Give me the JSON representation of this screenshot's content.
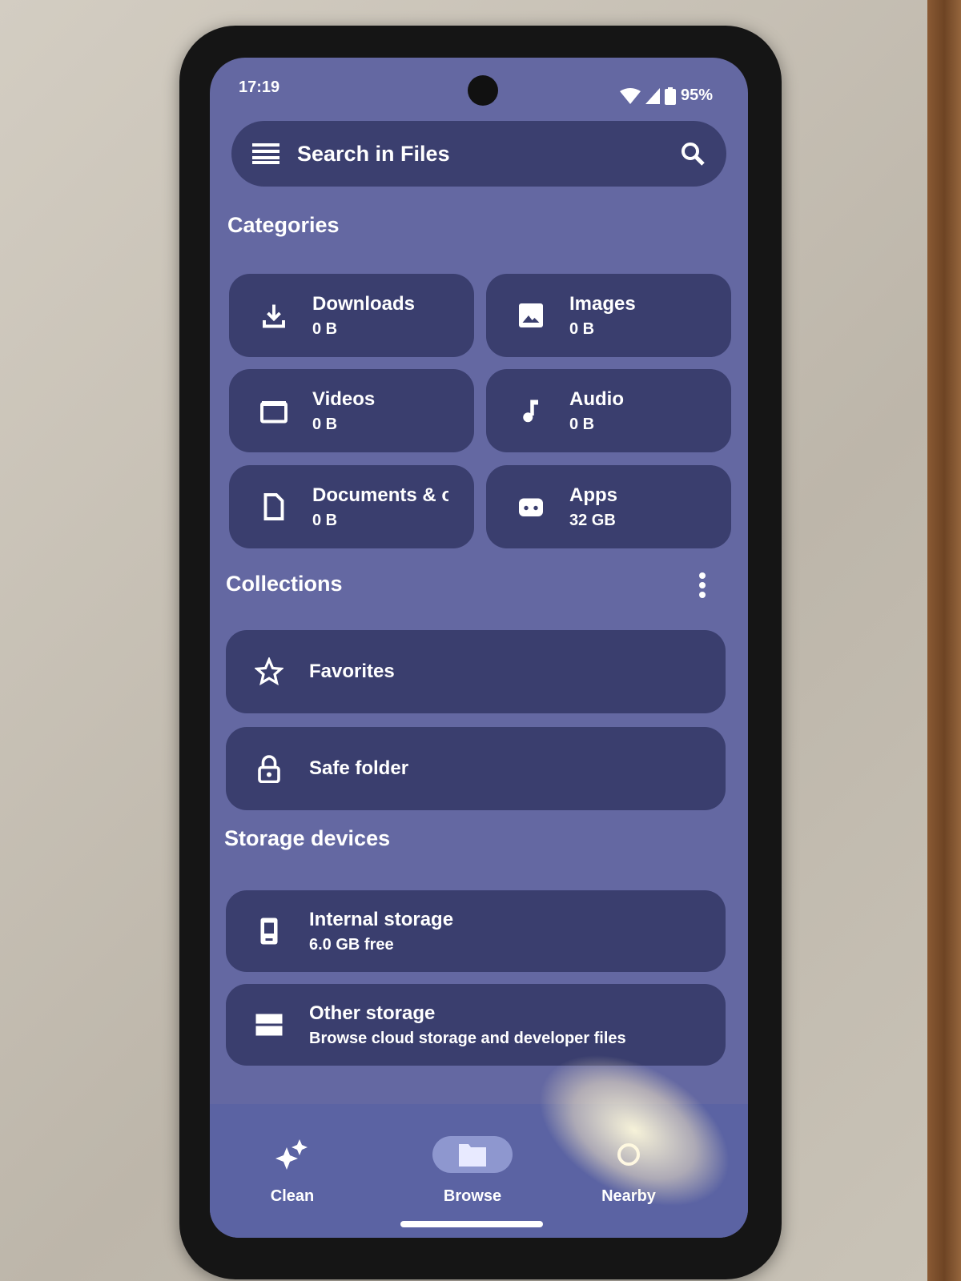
{
  "status": {
    "time": "17:19",
    "battery": "95%"
  },
  "search": {
    "placeholder": "Search in Files"
  },
  "categories": {
    "heading": "Categories",
    "items": [
      {
        "label": "Downloads",
        "size": "0 B",
        "icon": "download-icon"
      },
      {
        "label": "Images",
        "size": "0 B",
        "icon": "image-icon"
      },
      {
        "label": "Videos",
        "size": "0 B",
        "icon": "video-icon"
      },
      {
        "label": "Audio",
        "size": "0 B",
        "icon": "music-note-icon"
      },
      {
        "label": "Documents & o",
        "size": "0 B",
        "icon": "document-icon"
      },
      {
        "label": "Apps",
        "size": "32 GB",
        "icon": "android-icon"
      }
    ]
  },
  "collections": {
    "heading": "Collections",
    "items": [
      {
        "label": "Favorites",
        "icon": "star-icon"
      },
      {
        "label": "Safe folder",
        "icon": "lock-icon"
      }
    ]
  },
  "storage": {
    "heading": "Storage devices",
    "items": [
      {
        "label": "Internal storage",
        "sub": "6.0 GB free",
        "icon": "phone-icon"
      },
      {
        "label": "Other storage",
        "sub": "Browse cloud storage and developer files",
        "icon": "storage-icon"
      }
    ]
  },
  "nav": {
    "items": [
      {
        "label": "Clean",
        "icon": "sparkle-icon"
      },
      {
        "label": "Browse",
        "icon": "folder-icon",
        "active": true
      },
      {
        "label": "Nearby",
        "icon": "share-icon"
      }
    ]
  },
  "colors": {
    "screen": "#6468a2",
    "card": "#3a3e6e",
    "nav": "#5b63a3",
    "active_pill": "#8e97cf"
  }
}
